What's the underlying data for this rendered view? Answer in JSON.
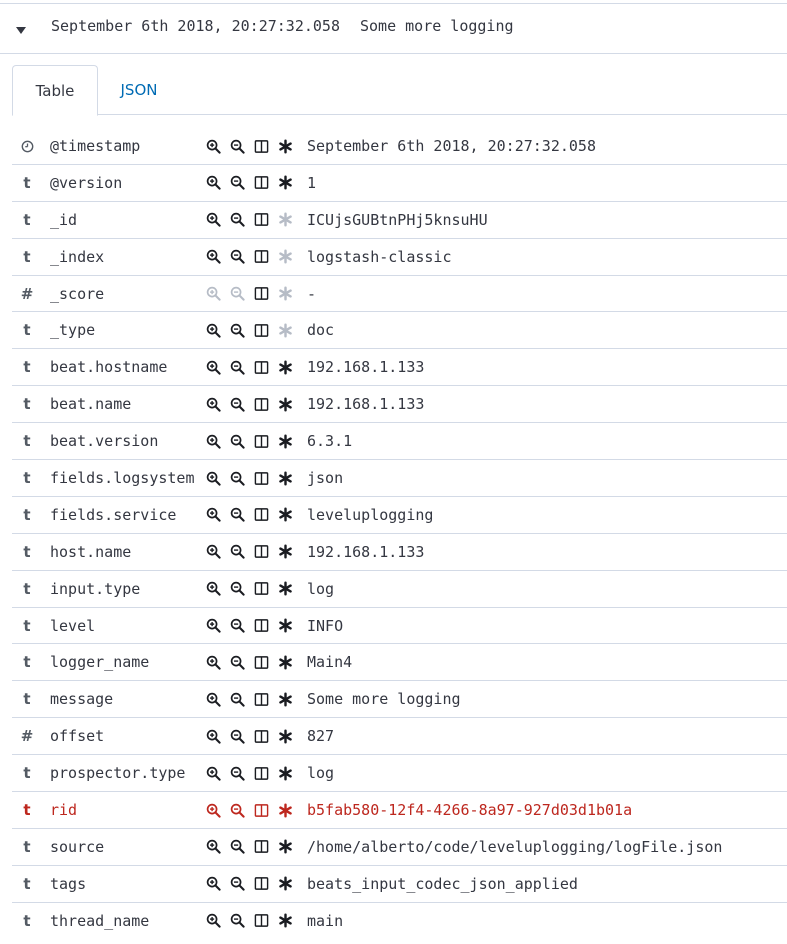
{
  "colors": {
    "accent": "#006bb4",
    "highlight": "#bd271e",
    "text": "#343741",
    "dim": "#b6bcc6"
  },
  "doc": {
    "timestamp": "September 6th 2018, 20:27:32.058",
    "message": "Some more logging"
  },
  "tabs": [
    {
      "label": "Table",
      "active": true
    },
    {
      "label": "JSON",
      "active": false
    }
  ],
  "rows": [
    {
      "type_icon": "clock-icon",
      "type_label": "",
      "name": "@timestamp",
      "value": "September 6th 2018, 20:27:32.058",
      "filter_enabled": true,
      "exists_enabled": true,
      "highlight": false
    },
    {
      "type_icon": "string-icon",
      "type_label": "t",
      "name": "@version",
      "value": "1",
      "filter_enabled": true,
      "exists_enabled": true,
      "highlight": false
    },
    {
      "type_icon": "string-icon",
      "type_label": "t",
      "name": "_id",
      "value": "ICUjsGUBtnPHj5knsuHU",
      "filter_enabled": true,
      "exists_enabled": false,
      "highlight": false
    },
    {
      "type_icon": "string-icon",
      "type_label": "t",
      "name": "_index",
      "value": "logstash-classic",
      "filter_enabled": true,
      "exists_enabled": false,
      "highlight": false
    },
    {
      "type_icon": "number-icon",
      "type_label": "#",
      "name": "_score",
      "value": " -",
      "filter_enabled": false,
      "exists_enabled": false,
      "highlight": false
    },
    {
      "type_icon": "string-icon",
      "type_label": "t",
      "name": "_type",
      "value": "doc",
      "filter_enabled": true,
      "exists_enabled": false,
      "highlight": false
    },
    {
      "type_icon": "string-icon",
      "type_label": "t",
      "name": "beat.hostname",
      "value": "192.168.1.133",
      "filter_enabled": true,
      "exists_enabled": true,
      "highlight": false
    },
    {
      "type_icon": "string-icon",
      "type_label": "t",
      "name": "beat.name",
      "value": "192.168.1.133",
      "filter_enabled": true,
      "exists_enabled": true,
      "highlight": false
    },
    {
      "type_icon": "string-icon",
      "type_label": "t",
      "name": "beat.version",
      "value": "6.3.1",
      "filter_enabled": true,
      "exists_enabled": true,
      "highlight": false
    },
    {
      "type_icon": "string-icon",
      "type_label": "t",
      "name": "fields.logsystem",
      "value": "json",
      "filter_enabled": true,
      "exists_enabled": true,
      "highlight": false
    },
    {
      "type_icon": "string-icon",
      "type_label": "t",
      "name": "fields.service",
      "value": "leveluplogging",
      "filter_enabled": true,
      "exists_enabled": true,
      "highlight": false
    },
    {
      "type_icon": "string-icon",
      "type_label": "t",
      "name": "host.name",
      "value": "192.168.1.133",
      "filter_enabled": true,
      "exists_enabled": true,
      "highlight": false
    },
    {
      "type_icon": "string-icon",
      "type_label": "t",
      "name": "input.type",
      "value": "log",
      "filter_enabled": true,
      "exists_enabled": true,
      "highlight": false
    },
    {
      "type_icon": "string-icon",
      "type_label": "t",
      "name": "level",
      "value": "INFO",
      "filter_enabled": true,
      "exists_enabled": true,
      "highlight": false
    },
    {
      "type_icon": "string-icon",
      "type_label": "t",
      "name": "logger_name",
      "value": "Main4",
      "filter_enabled": true,
      "exists_enabled": true,
      "highlight": false
    },
    {
      "type_icon": "string-icon",
      "type_label": "t",
      "name": "message",
      "value": "Some more logging",
      "filter_enabled": true,
      "exists_enabled": true,
      "highlight": false
    },
    {
      "type_icon": "number-icon",
      "type_label": "#",
      "name": "offset",
      "value": "827",
      "filter_enabled": true,
      "exists_enabled": true,
      "highlight": false
    },
    {
      "type_icon": "string-icon",
      "type_label": "t",
      "name": "prospector.type",
      "value": "log",
      "filter_enabled": true,
      "exists_enabled": true,
      "highlight": false
    },
    {
      "type_icon": "string-icon",
      "type_label": "t",
      "name": "rid",
      "value": "b5fab580-12f4-4266-8a97-927d03d1b01a",
      "filter_enabled": true,
      "exists_enabled": true,
      "highlight": true
    },
    {
      "type_icon": "string-icon",
      "type_label": "t",
      "name": "source",
      "value": "/home/alberto/code/leveluplogging/logFile.json",
      "filter_enabled": true,
      "exists_enabled": true,
      "highlight": false
    },
    {
      "type_icon": "string-icon",
      "type_label": "t",
      "name": "tags",
      "value": "beats_input_codec_json_applied",
      "filter_enabled": true,
      "exists_enabled": true,
      "highlight": false
    },
    {
      "type_icon": "string-icon",
      "type_label": "t",
      "name": "thread_name",
      "value": "main",
      "filter_enabled": true,
      "exists_enabled": true,
      "highlight": false
    }
  ]
}
